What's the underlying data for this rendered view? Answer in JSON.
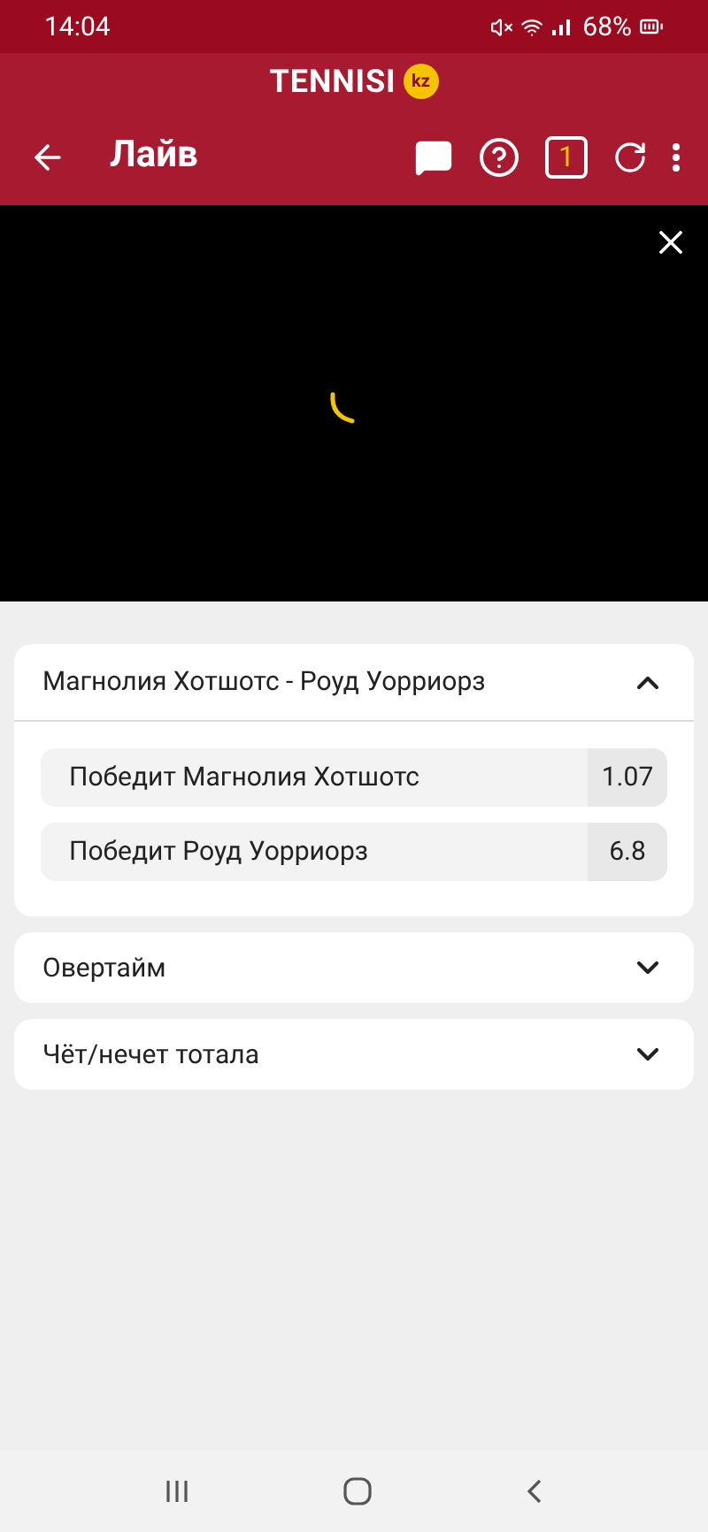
{
  "status_bar": {
    "time": "14:04",
    "battery": "68%"
  },
  "brand": {
    "name": "TENNISI",
    "badge": "kz"
  },
  "header": {
    "title": "Лайв",
    "coupon_count": "1"
  },
  "video": {
    "loading": true
  },
  "markets": [
    {
      "title": "Магнолия Хотшотс - Роуд Уорриорз",
      "expanded": true,
      "outcomes": [
        {
          "label": "Победит Магнолия Хотшотс",
          "odds": "1.07"
        },
        {
          "label": "Победит Роуд Уорриорз",
          "odds": "6.8"
        }
      ]
    },
    {
      "title": "Овертайм",
      "expanded": false
    },
    {
      "title": "Чёт/нечет тотала",
      "expanded": false
    }
  ]
}
